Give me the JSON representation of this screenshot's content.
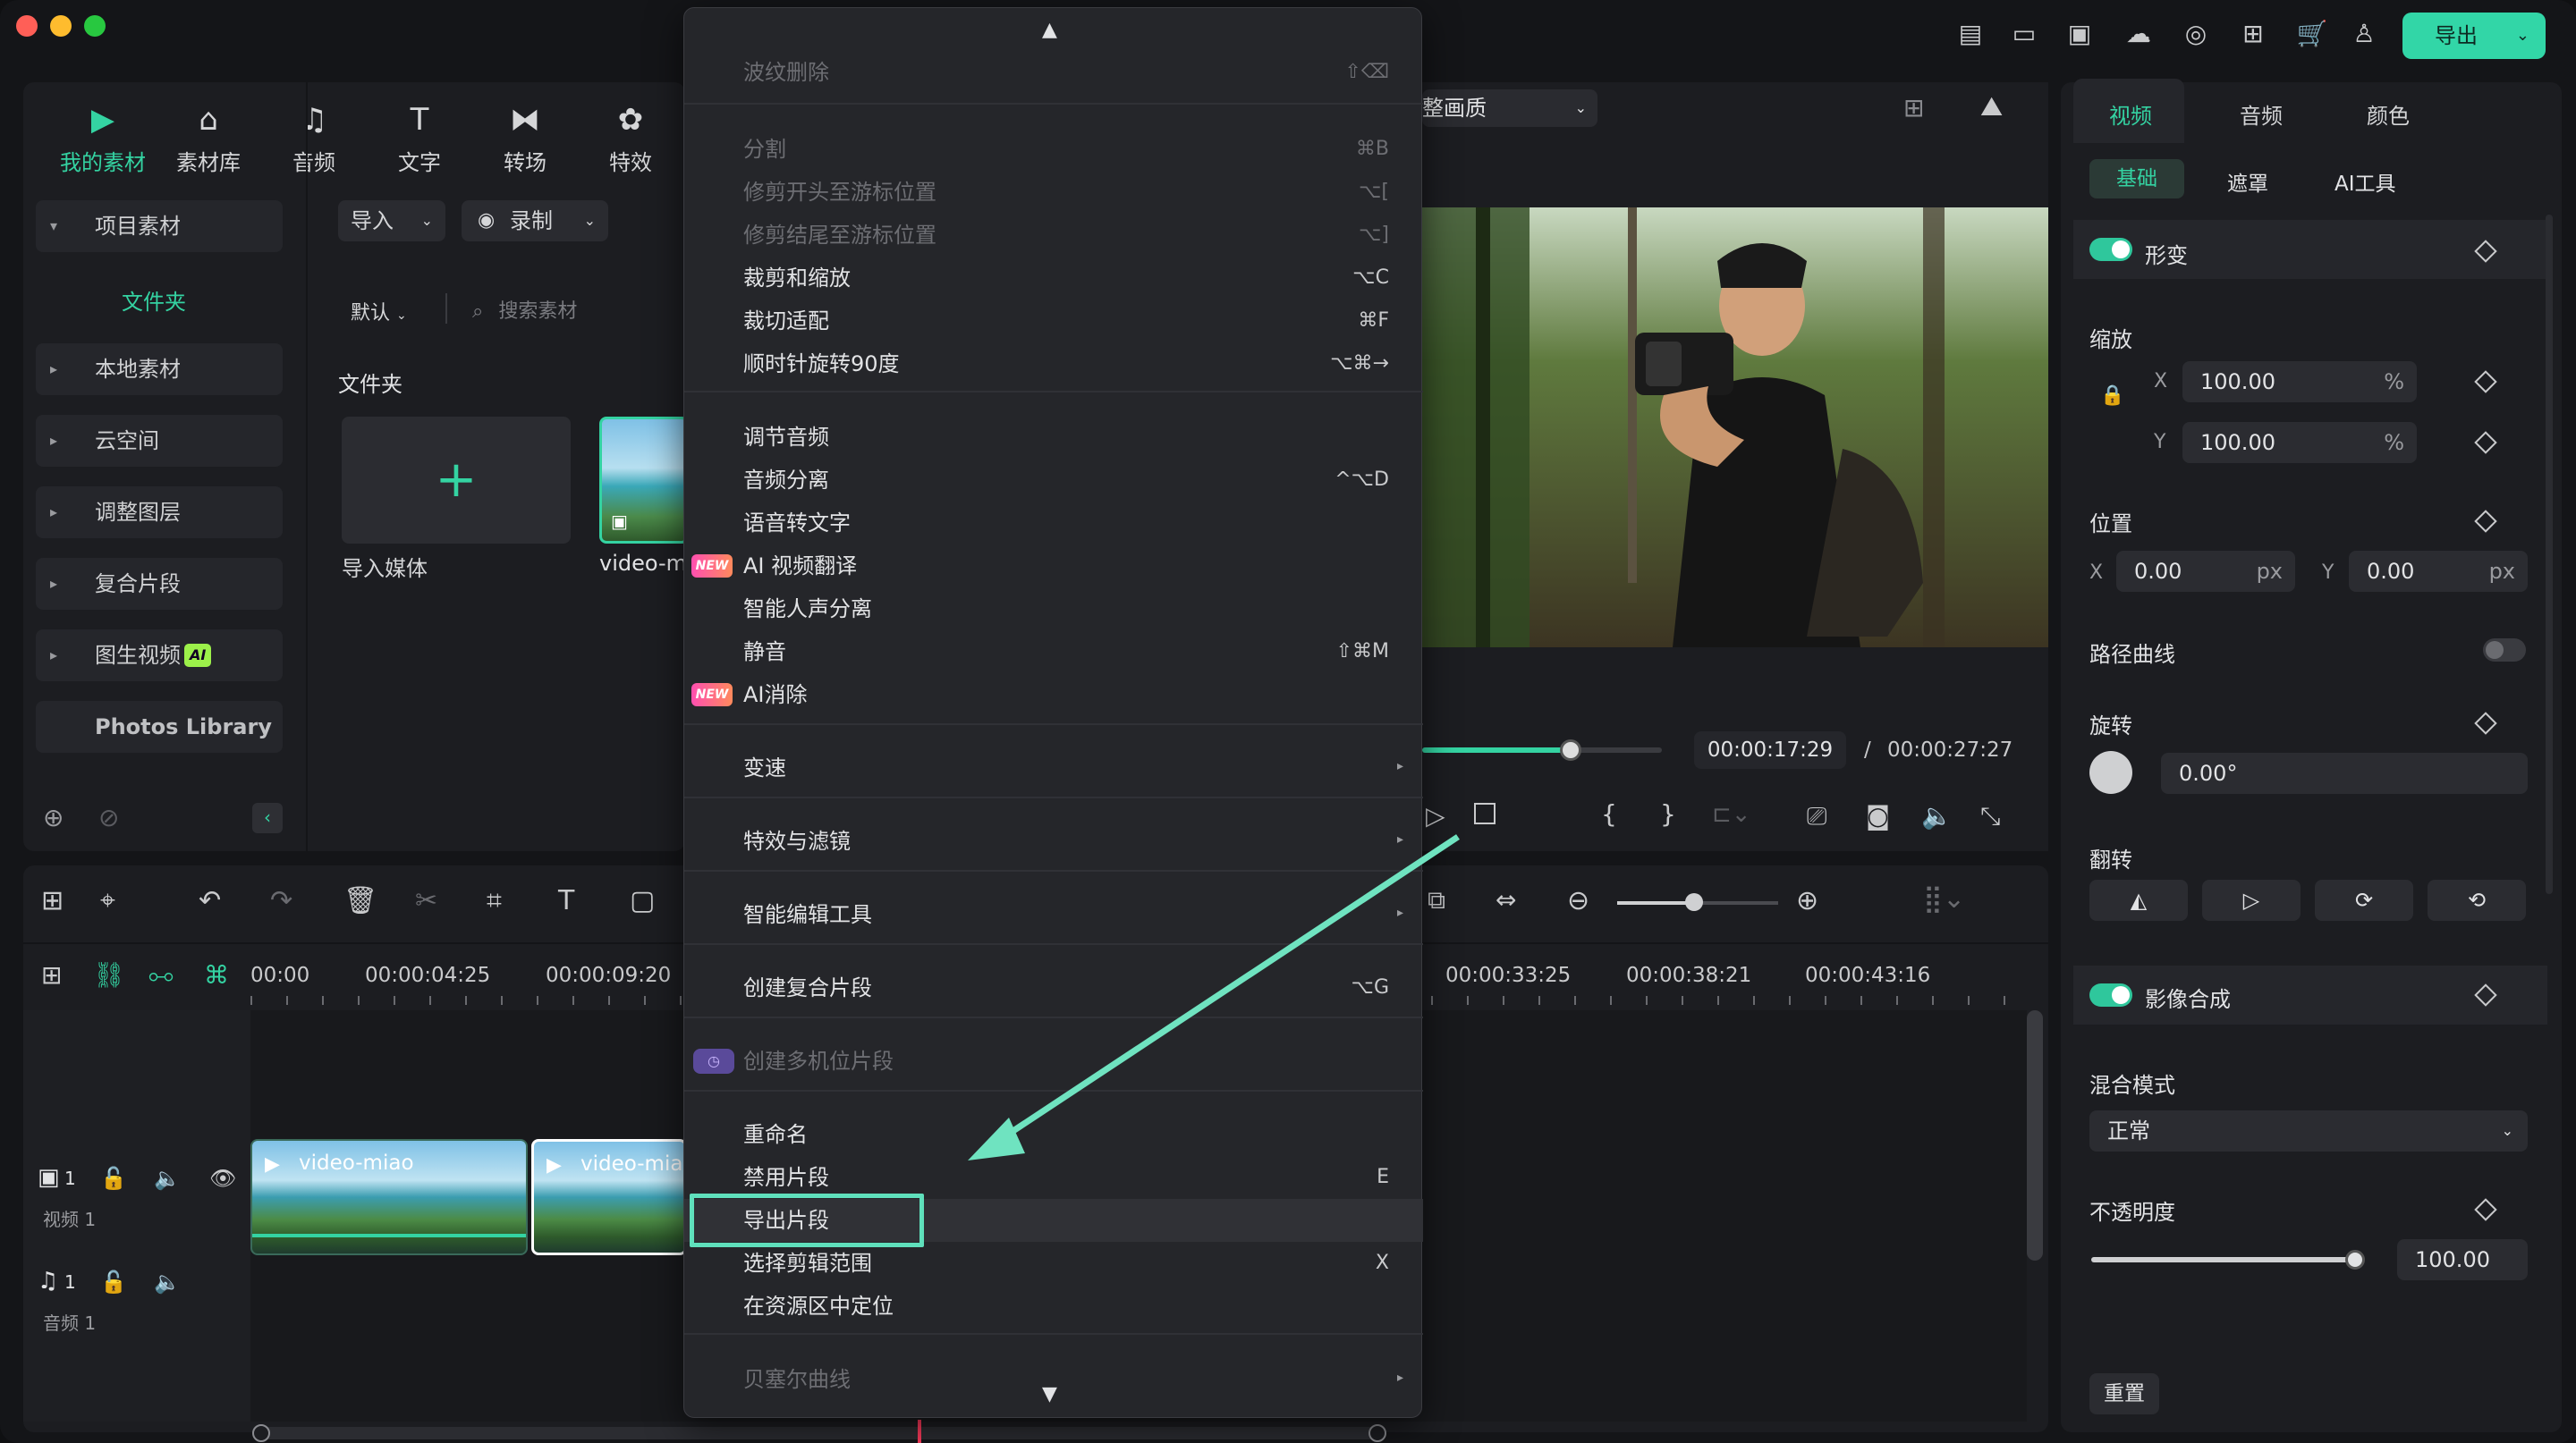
{
  "toolbar_nav": [
    {
      "label": "我的素材",
      "icon": "my-media-icon"
    },
    {
      "label": "素材库",
      "icon": "stock-library-icon"
    },
    {
      "label": "音频",
      "icon": "audio-note-icon"
    },
    {
      "label": "文字",
      "icon": "text-t-icon"
    },
    {
      "label": "转场",
      "icon": "transition-icon"
    },
    {
      "label": "特效",
      "icon": "effects-icon"
    }
  ],
  "top_right": {
    "export_label": "导出"
  },
  "sidebar": {
    "items": [
      {
        "label": "项目素材"
      },
      {
        "label": "文件夹"
      },
      {
        "label": "本地素材"
      },
      {
        "label": "云空间"
      },
      {
        "label": "调整图层"
      },
      {
        "label": "复合片段"
      },
      {
        "label": "图生视频"
      },
      {
        "label": "Photos Library"
      }
    ],
    "ai_badge": "AI"
  },
  "media": {
    "import_label": "导入",
    "record_label": "录制",
    "sort_label": "默认",
    "search_placeholder": "搜索素材",
    "folder_heading": "文件夹",
    "import_media_label": "导入媒体",
    "clip_name": "video-m"
  },
  "context_menu": {
    "items": [
      {
        "label": "波纹删除",
        "shortcut": "⇧⌫",
        "disabled": true
      },
      {
        "label": "分割",
        "shortcut": "⌘B",
        "disabled": true
      },
      {
        "label": "修剪开头至游标位置",
        "shortcut": "⌥[",
        "disabled": true
      },
      {
        "label": "修剪结尾至游标位置",
        "shortcut": "⌥]",
        "disabled": true
      },
      {
        "label": "裁剪和缩放",
        "shortcut": "⌥C"
      },
      {
        "label": "裁切适配",
        "shortcut": "⌘F"
      },
      {
        "label": "顺时针旋转90度",
        "shortcut": "⌥⌘→"
      },
      {
        "label": "调节音频",
        "shortcut": ""
      },
      {
        "label": "音频分离",
        "shortcut": "^⌥D"
      },
      {
        "label": "语音转文字",
        "shortcut": ""
      },
      {
        "label": "AI 视频翻译",
        "shortcut": "",
        "badge": "NEW"
      },
      {
        "label": "智能人声分离",
        "shortcut": ""
      },
      {
        "label": "静音",
        "shortcut": "⇧⌘M"
      },
      {
        "label": "AI消除",
        "shortcut": "",
        "badge": "NEW"
      },
      {
        "label": "变速",
        "shortcut": ""
      },
      {
        "label": "特效与滤镜",
        "shortcut": ""
      },
      {
        "label": "智能编辑工具",
        "shortcut": ""
      },
      {
        "label": "创建复合片段",
        "shortcut": "⌥G"
      },
      {
        "label": "创建多机位片段",
        "shortcut": "",
        "disabled": true
      },
      {
        "label": "重命名",
        "shortcut": ""
      },
      {
        "label": "禁用片段",
        "shortcut": "E"
      },
      {
        "label": "导出片段",
        "shortcut": ""
      },
      {
        "label": "选择剪辑范围",
        "shortcut": "X"
      },
      {
        "label": "在资源区中定位",
        "shortcut": ""
      },
      {
        "label": "贝塞尔曲线",
        "shortcut": "",
        "disabled": true
      }
    ],
    "highlighted": "导出片段"
  },
  "preview": {
    "quality_label": "整画质",
    "current_time": "00:00:17:29",
    "separator": "/",
    "total_time": "00:00:27:27",
    "progress": 0.62
  },
  "right_panel": {
    "tabs": [
      "视频",
      "音频",
      "颜色"
    ],
    "subtabs": [
      "基础",
      "遮罩",
      "AI工具"
    ],
    "transform_label": "形变",
    "scale_label": "缩放",
    "scale_x": "100.00",
    "scale_y": "100.00",
    "scale_unit": "%",
    "position_label": "位置",
    "pos_x": "0.00",
    "pos_y": "0.00",
    "pos_unit": "px",
    "path_curve_label": "路径曲线",
    "rotate_label": "旋转",
    "rotate_value": "0.00°",
    "flip_label": "翻转",
    "composite_label": "影像合成",
    "blend_label": "混合模式",
    "blend_value": "正常",
    "opacity_label": "不透明度",
    "opacity_value": "100.00",
    "reset_label": "重置",
    "axis_x": "X",
    "axis_y": "Y"
  },
  "timeline": {
    "ruler": [
      "00:00",
      "00:00:04:25",
      "00:00:09:20",
      "00:00:33:25",
      "00:00:38:21",
      "00:00:43:16"
    ],
    "video_track_label": "视频 1",
    "audio_track_label": "音频 1",
    "track_num": "1",
    "clips": [
      "video-miao",
      "video-miao"
    ]
  }
}
